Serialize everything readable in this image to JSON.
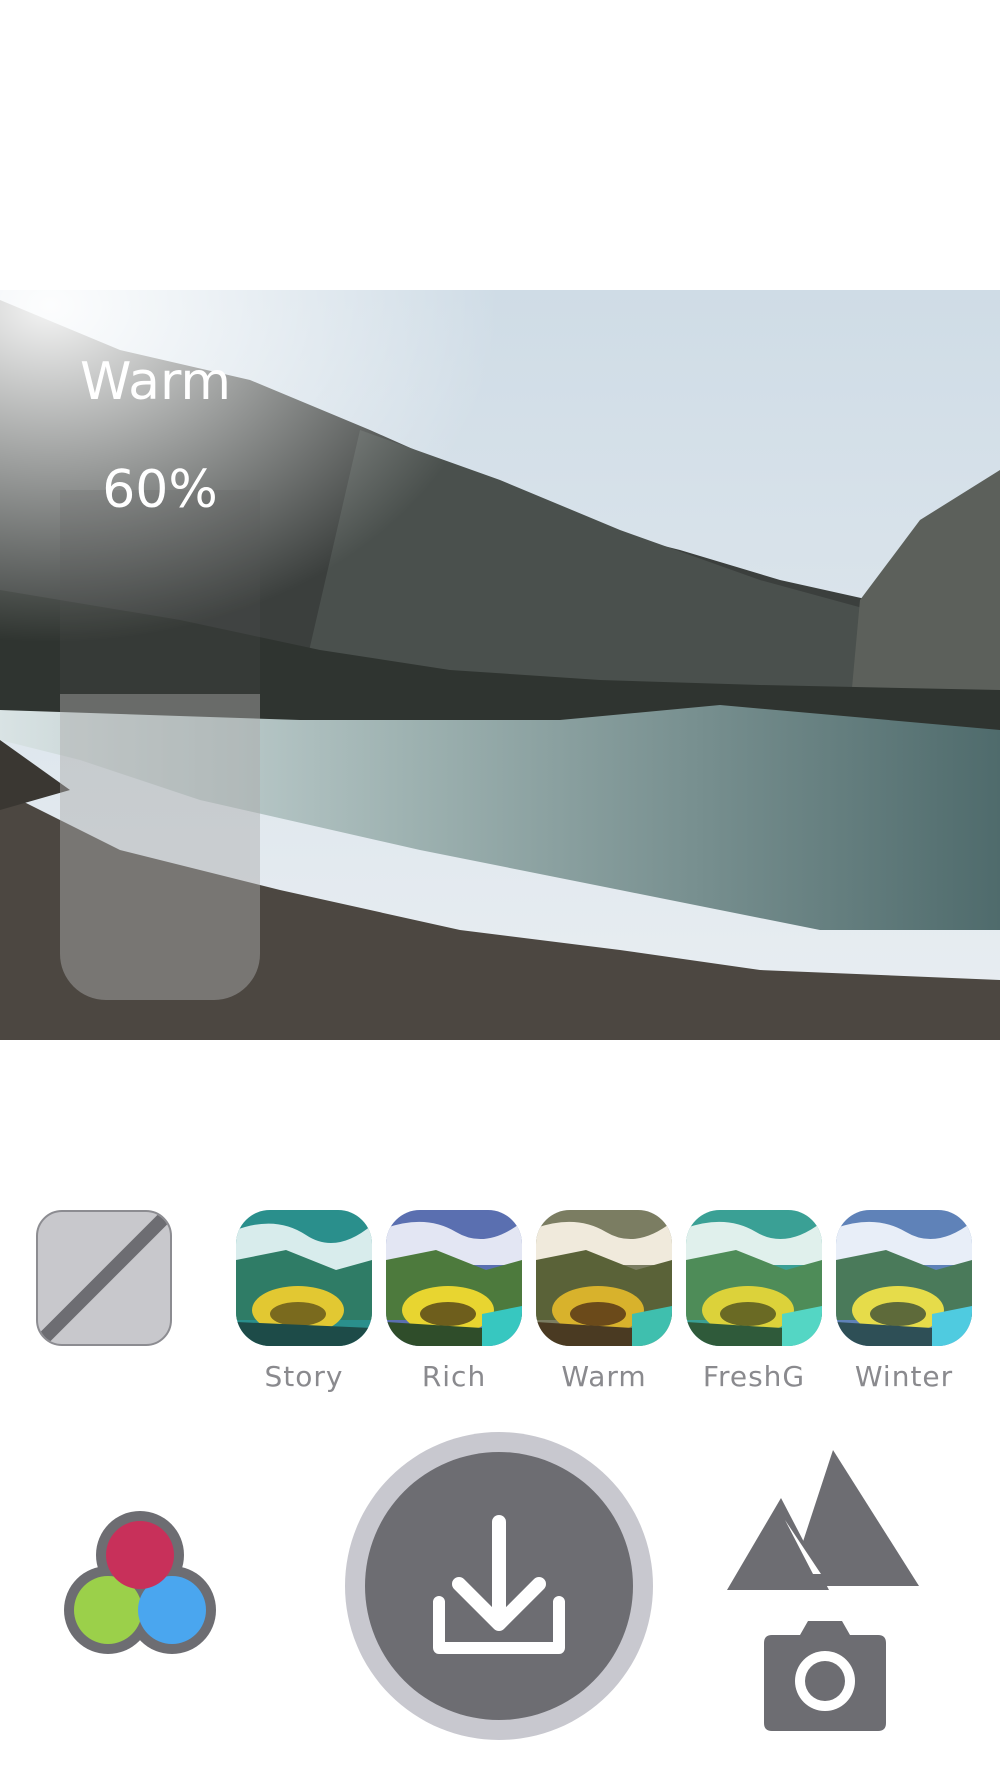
{
  "adjustment": {
    "filter_name": "Warm",
    "intensity_label": "60%",
    "intensity_value": 0.6
  },
  "filters": [
    {
      "label": "Story"
    },
    {
      "label": "Rich"
    },
    {
      "label": "Warm"
    },
    {
      "label": "FreshG"
    },
    {
      "label": "Winter"
    }
  ],
  "icons": {
    "none_filter": "no-filter-icon",
    "color_mix": "rgb-circles-icon",
    "save": "download-icon",
    "gallery": "mountains-icon",
    "camera": "camera-icon"
  },
  "colors": {
    "toolbar_gray": "#6d6d72",
    "ring_gray": "#c8c8cf",
    "label_gray": "#8a8a8e",
    "red": "#c8305a",
    "green": "#9bd04a",
    "blue": "#4aa6ef"
  }
}
